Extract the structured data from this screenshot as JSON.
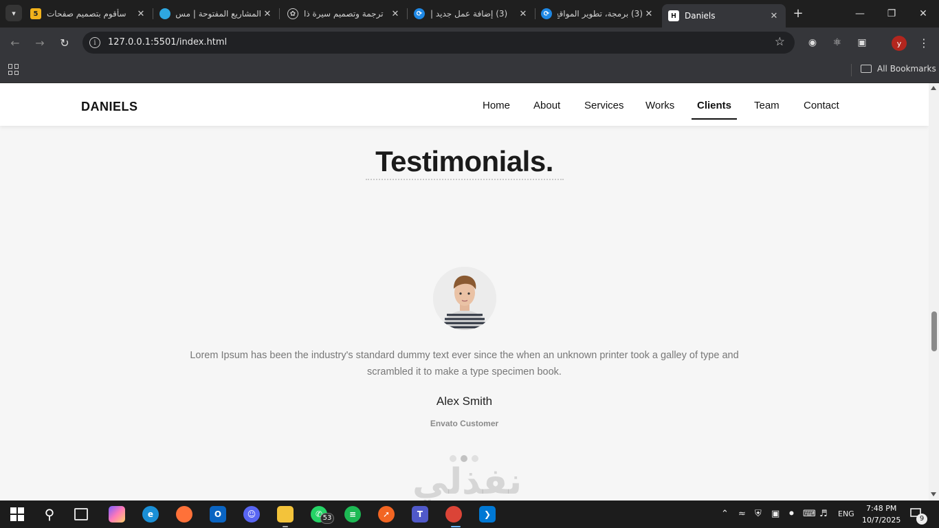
{
  "browser": {
    "tabs": [
      {
        "title": "سأقوم بتصميم صفحات",
        "favicon": "khamsat-icon",
        "active": false
      },
      {
        "title": "المشاريع المفتوحة | مس",
        "favicon": "mostaql-icon",
        "active": false
      },
      {
        "title": "ترجمة وتصميم سيرة ذا",
        "favicon": "chatgpt-icon",
        "active": false
      },
      {
        "title": "(3) إضافة عمل جديد |",
        "favicon": "nafezly-icon",
        "active": false
      },
      {
        "title": "(3) برمجة، تطوير المواقع",
        "favicon": "nafezly-icon",
        "active": false
      },
      {
        "title": "Daniels",
        "favicon": "h-icon",
        "active": true
      }
    ],
    "url": "127.0.0.1:5501/index.html",
    "profile_initial": "y",
    "bookmarks_label": "All Bookmarks"
  },
  "site": {
    "logo": "DANIELS",
    "nav": [
      {
        "label": "Home",
        "active": false
      },
      {
        "label": "About",
        "active": false
      },
      {
        "label": "Services",
        "active": false
      },
      {
        "label": "Works",
        "active": false
      },
      {
        "label": "Clients",
        "active": true
      },
      {
        "label": "Team",
        "active": false
      },
      {
        "label": "Contact",
        "active": false
      }
    ],
    "section_title": "Testimonials.",
    "testimonial": {
      "quote": "Lorem Ipsum has been the industry's standard dummy text ever since the when an unknown printer took a galley of type and scrambled it to make a type specimen book.",
      "name": "Alex Smith",
      "role": "Envato Customer"
    },
    "slider_dots": 3,
    "active_dot": 2
  },
  "watermark": "نفذلي",
  "taskbar": {
    "whatsapp_badge": "53",
    "language": "ENG",
    "time": "7:48 PM",
    "date": "10/7/2025",
    "notifications": "9"
  },
  "colors": {
    "chrome_dark": "#1f1f1f",
    "chrome_toolbar": "#35363a",
    "page_bg": "#f6f6f6",
    "text_dark": "#1b1b1b",
    "text_muted": "#777777"
  }
}
